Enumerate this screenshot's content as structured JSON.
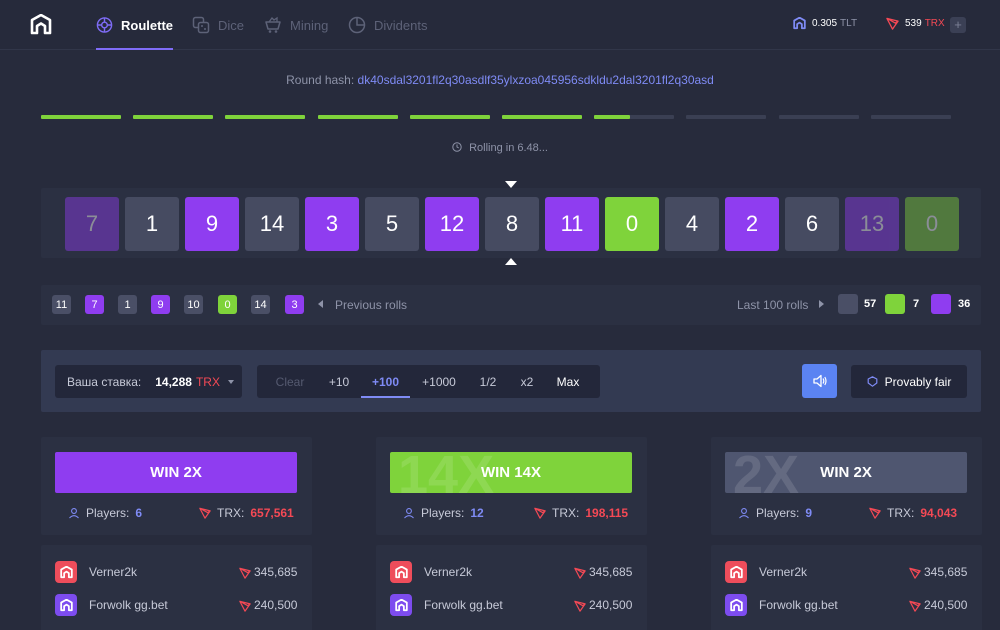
{
  "nav": {
    "tabs": [
      {
        "label": "Roulette",
        "icon": "roulette-icon",
        "active": true
      },
      {
        "label": "Dice",
        "icon": "dice-icon",
        "active": false
      },
      {
        "label": "Mining",
        "icon": "mining-cart-icon",
        "active": false
      },
      {
        "label": "Dividents",
        "icon": "pie-chart-icon",
        "active": false
      }
    ],
    "balances": [
      {
        "amount": "0.305",
        "currency": "TLT",
        "icon": "tlt-logo-icon"
      },
      {
        "amount": "539",
        "currency": "TRX",
        "icon": "trx-logo-icon"
      }
    ],
    "add_label": "+"
  },
  "hash": {
    "label": "Round hash:",
    "value": "dk40sdal3201fl2q30asdlf35ylxzoa045956sdkldu2dal3201fl2q30asd"
  },
  "progress": {
    "segments_total": 10,
    "segments_filled": 6,
    "partial_fraction": 0.45
  },
  "rolling": {
    "text": "Rolling in 6.48..."
  },
  "roulette": [
    {
      "n": "7",
      "color": "purple",
      "fade": true
    },
    {
      "n": "1",
      "color": "grey"
    },
    {
      "n": "9",
      "color": "purple"
    },
    {
      "n": "14",
      "color": "grey"
    },
    {
      "n": "3",
      "color": "purple"
    },
    {
      "n": "5",
      "color": "grey"
    },
    {
      "n": "12",
      "color": "purple"
    },
    {
      "n": "8",
      "color": "grey"
    },
    {
      "n": "11",
      "color": "purple"
    },
    {
      "n": "0",
      "color": "green"
    },
    {
      "n": "4",
      "color": "grey"
    },
    {
      "n": "2",
      "color": "purple"
    },
    {
      "n": "6",
      "color": "grey"
    },
    {
      "n": "13",
      "color": "purple",
      "fade": true
    },
    {
      "n": "0",
      "color": "green",
      "fade": true
    }
  ],
  "history": {
    "chips": [
      {
        "n": "11",
        "color": "grey"
      },
      {
        "n": "7",
        "color": "purple"
      },
      {
        "n": "1",
        "color": "grey"
      },
      {
        "n": "9",
        "color": "purple"
      },
      {
        "n": "10",
        "color": "grey"
      },
      {
        "n": "0",
        "color": "green"
      },
      {
        "n": "14",
        "color": "grey"
      },
      {
        "n": "3",
        "color": "purple"
      }
    ],
    "previous_label": "Previous rolls",
    "last_label": "Last 100 rolls",
    "stats": [
      {
        "color": "grey",
        "value": "57"
      },
      {
        "color": "green",
        "value": "7"
      },
      {
        "color": "purple",
        "value": "36"
      }
    ]
  },
  "bet": {
    "label": "Ваша ставка:",
    "amount": "14,288",
    "currency": "TRX",
    "quick": [
      {
        "label": "Clear",
        "state": "dim"
      },
      {
        "label": "+10",
        "state": "normal"
      },
      {
        "label": "+100",
        "state": "active"
      },
      {
        "label": "+1000",
        "state": "normal"
      },
      {
        "label": "1/2",
        "state": "normal"
      },
      {
        "label": "x2",
        "state": "normal"
      },
      {
        "label": "Max",
        "state": "white"
      }
    ],
    "fair_label": "Provably fair"
  },
  "columns": [
    {
      "win_label": "WIN 2X",
      "color": "purple",
      "watermark": "",
      "players_label": "Players:",
      "players": "6",
      "trx_label": "TRX:",
      "trx": "657,561",
      "rows": [
        {
          "name": "Verner2k",
          "amount": "345,685",
          "avatar": "red"
        },
        {
          "name": "Forwolk gg.bet",
          "amount": "240,500",
          "avatar": "violet"
        }
      ]
    },
    {
      "win_label": "WIN 14X",
      "color": "green",
      "watermark": "14X",
      "players_label": "Players:",
      "players": "12",
      "trx_label": "TRX:",
      "trx": "198,115",
      "rows": [
        {
          "name": "Verner2k",
          "amount": "345,685",
          "avatar": "red"
        },
        {
          "name": "Forwolk gg.bet",
          "amount": "240,500",
          "avatar": "violet"
        }
      ]
    },
    {
      "win_label": "WIN 2X",
      "color": "grey",
      "watermark": "2X",
      "players_label": "Players:",
      "players": "9",
      "trx_label": "TRX:",
      "trx": "94,043",
      "rows": [
        {
          "name": "Verner2k",
          "amount": "345,685",
          "avatar": "red"
        },
        {
          "name": "Forwolk gg.bet",
          "amount": "240,500",
          "avatar": "violet"
        }
      ]
    }
  ],
  "colors": {
    "purple": "#8f3df0",
    "green": "#7fd33b",
    "grey": "#464b61",
    "accent": "#7f8bf5",
    "trx": "#f44955"
  }
}
